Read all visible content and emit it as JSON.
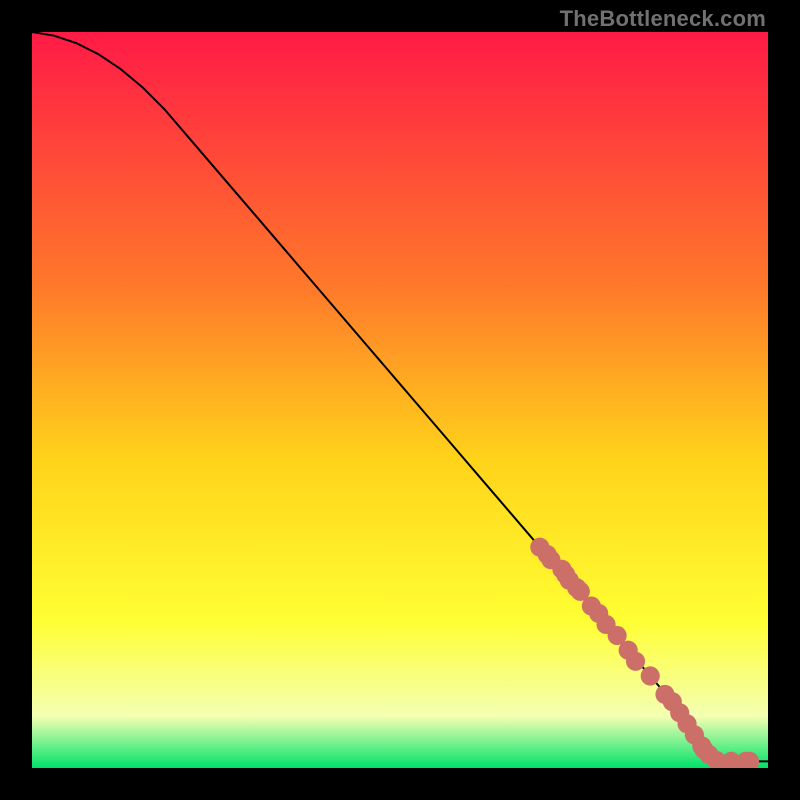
{
  "watermark": "TheBottleneck.com",
  "colors": {
    "grad_top": "#ff1a46",
    "grad_mid1": "#ff7a2a",
    "grad_mid2": "#ffd31a",
    "grad_mid3": "#ffff33",
    "grad_mid4": "#f4ffb3",
    "grad_bottom": "#00e26a",
    "curve": "#000000",
    "marker_fill": "#cd6f69",
    "marker_stroke": "#cd6f69"
  },
  "chart_data": {
    "type": "line",
    "title": "",
    "xlabel": "",
    "ylabel": "",
    "xlim": [
      0,
      100
    ],
    "ylim": [
      0,
      100
    ],
    "series": [
      {
        "name": "curve",
        "x": [
          0,
          3,
          6,
          9,
          12,
          15,
          18,
          21,
          24,
          27,
          30,
          33,
          36,
          39,
          42,
          45,
          48,
          51,
          54,
          57,
          60,
          63,
          66,
          69,
          72,
          75,
          78,
          81,
          84,
          87,
          88,
          89,
          90,
          91,
          92,
          93,
          95,
          97,
          100
        ],
        "y": [
          100,
          99.5,
          98.5,
          97,
          95,
          92.5,
          89.5,
          86,
          82.5,
          79,
          75.5,
          72,
          68.5,
          65,
          61.5,
          58,
          54.5,
          51,
          47.5,
          44,
          40.5,
          37,
          33.5,
          30,
          26.5,
          23,
          19.5,
          16,
          12.5,
          9,
          7.5,
          6,
          4.5,
          3,
          2,
          1.3,
          0.9,
          0.9,
          0.9
        ]
      }
    ],
    "markers": {
      "name": "points",
      "x": [
        69,
        70,
        70.5,
        72,
        72.5,
        73,
        74,
        74.5,
        76,
        77,
        78,
        79.5,
        81,
        82,
        84,
        86,
        87,
        88,
        89,
        90,
        91,
        91.3,
        92,
        93,
        95,
        97,
        97.5
      ],
      "y": [
        30,
        29,
        28.3,
        27,
        26.3,
        25.5,
        24.5,
        24,
        22,
        21,
        19.5,
        18,
        16,
        14.5,
        12.5,
        10,
        9,
        7.5,
        6,
        4.5,
        3,
        2.5,
        1.8,
        1.0,
        0.9,
        0.9,
        0.9
      ]
    }
  }
}
